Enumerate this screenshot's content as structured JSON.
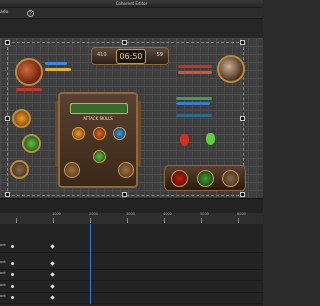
{
  "window": {
    "title": "Coherent Editor"
  },
  "menubar": {
    "menu": "ado",
    "help_icon": "?"
  },
  "hud": {
    "timer": {
      "left_value": "410",
      "clock": "06:50",
      "right_value": "59"
    },
    "panel_label": "ATTACK SKILLS"
  },
  "timeline": {
    "ruler_labels": [
      "1000",
      "2000",
      "3000",
      "4000",
      "5000",
      "6000"
    ],
    "tracks": [
      {
        "name": "ont"
      },
      {
        "name": "ont"
      },
      {
        "name": "ont"
      },
      {
        "name": "ont"
      },
      {
        "name": "ont"
      }
    ]
  }
}
